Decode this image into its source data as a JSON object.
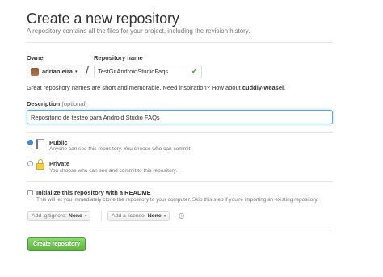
{
  "header": {
    "title": "Create a new repository",
    "subtitle": "A repository contains all the files for your project, including the revision history."
  },
  "form": {
    "owner_label": "Owner",
    "owner_value": "adrianleira",
    "repo_label": "Repository name",
    "repo_value": "TestGitAndroidStudioFaqs",
    "slash": "/",
    "hint_text": "Great repository names are short and memorable. Need inspiration? How about ",
    "hint_suggestion": "cuddly-weasel",
    "hint_end": ".",
    "description_label": "Description",
    "description_optional": "(optional)",
    "description_value": "Repositorio de testeo para Android Studio FAQs"
  },
  "visibility": {
    "public_title": "Public",
    "public_desc": "Anyone can see this repository. You choose who can commit.",
    "private_title": "Private",
    "private_desc": "You choose who can see and commit to this repository.",
    "selected": "public"
  },
  "init": {
    "label": "Initialize this repository with a README",
    "desc": "This will let you immediately clone the repository to your computer. Skip this step if you're importing an existing repository.",
    "checked": false
  },
  "addons": {
    "gitignore_prefix": "Add .gitignore:",
    "gitignore_value": "None",
    "license_prefix": "Add a license:",
    "license_value": "None",
    "info_glyph": "i"
  },
  "submit": {
    "label": "Create repository"
  },
  "icons": {
    "caret": "▾",
    "check": "✓"
  },
  "colors": {
    "accent_blue": "#4183c4",
    "success_green": "#55a532",
    "button_green": "#60b044"
  }
}
